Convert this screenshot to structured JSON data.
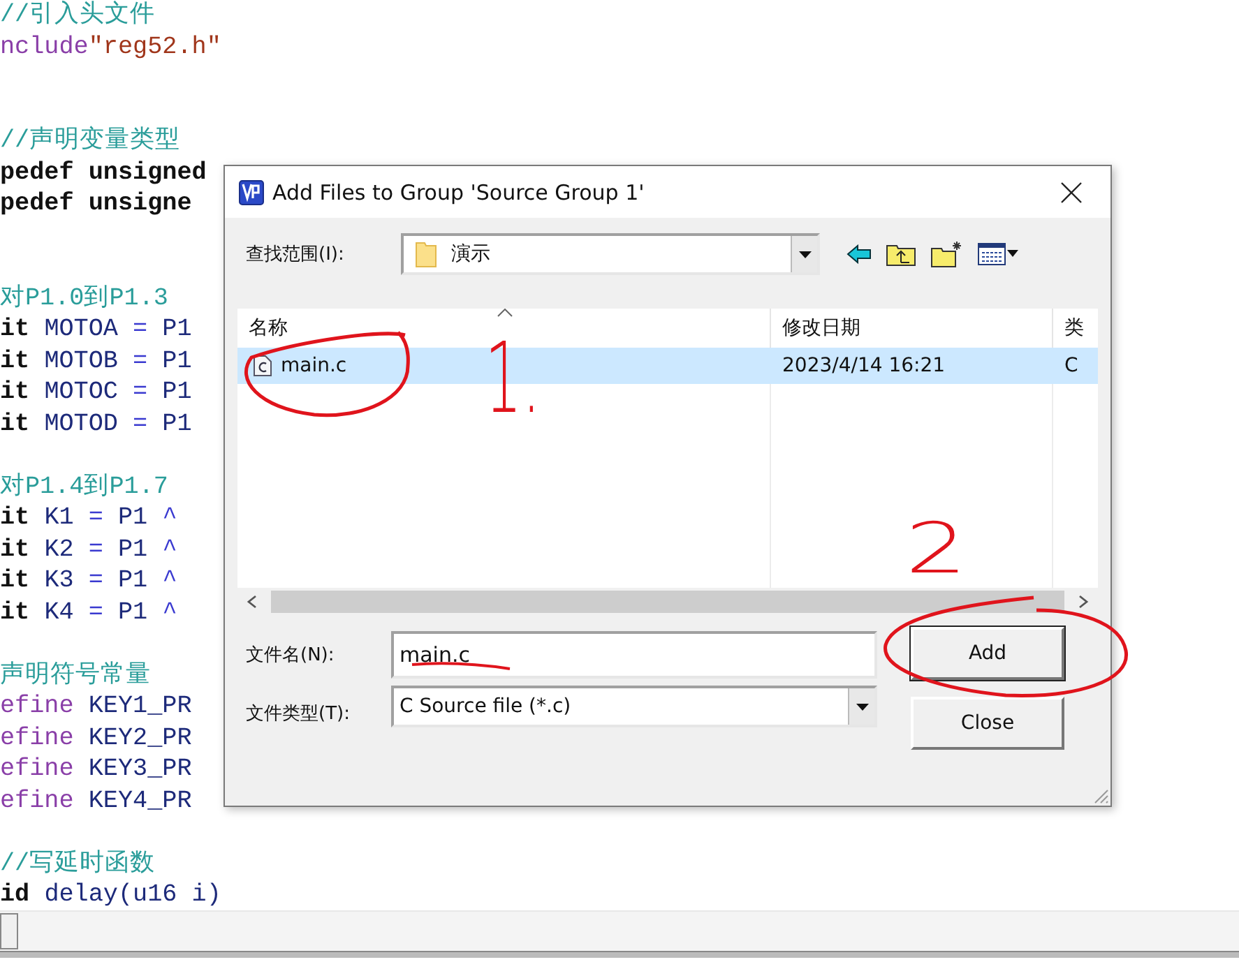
{
  "editor": {
    "lines": [
      {
        "kind": "code",
        "tokens": [
          {
            "kind": "comment",
            "text": "//引入头文件"
          }
        ]
      },
      {
        "kind": "code",
        "tokens": [
          {
            "kind": "directive",
            "text": "nclude"
          },
          {
            "kind": "string",
            "text": "\"reg52.h\""
          }
        ]
      },
      {
        "kind": "blank"
      },
      {
        "kind": "blank"
      },
      {
        "kind": "code",
        "tokens": [
          {
            "kind": "comment",
            "text": "//声明变量类型"
          }
        ]
      },
      {
        "kind": "code",
        "tokens": [
          {
            "kind": "keyword",
            "text": "pedef unsigned"
          }
        ]
      },
      {
        "kind": "code",
        "tokens": [
          {
            "kind": "keyword",
            "text": "pedef unsigne"
          }
        ]
      },
      {
        "kind": "blank"
      },
      {
        "kind": "blank"
      },
      {
        "kind": "code",
        "tokens": [
          {
            "kind": "comment",
            "text": "对P1.0到P1.3"
          }
        ]
      },
      {
        "kind": "code",
        "tokens": [
          {
            "kind": "keyword",
            "text": "it "
          },
          {
            "kind": "name",
            "text": "MOTOA "
          },
          {
            "kind": "operator",
            "text": "= "
          },
          {
            "kind": "name",
            "text": "P1"
          }
        ]
      },
      {
        "kind": "code",
        "tokens": [
          {
            "kind": "keyword",
            "text": "it "
          },
          {
            "kind": "name",
            "text": "MOTOB "
          },
          {
            "kind": "operator",
            "text": "= "
          },
          {
            "kind": "name",
            "text": "P1"
          }
        ]
      },
      {
        "kind": "code",
        "tokens": [
          {
            "kind": "keyword",
            "text": "it "
          },
          {
            "kind": "name",
            "text": "MOTOC "
          },
          {
            "kind": "operator",
            "text": "= "
          },
          {
            "kind": "name",
            "text": "P1"
          }
        ]
      },
      {
        "kind": "code",
        "tokens": [
          {
            "kind": "keyword",
            "text": "it "
          },
          {
            "kind": "name",
            "text": "MOTOD "
          },
          {
            "kind": "operator",
            "text": "= "
          },
          {
            "kind": "name",
            "text": "P1"
          }
        ]
      },
      {
        "kind": "blank"
      },
      {
        "kind": "code",
        "tokens": [
          {
            "kind": "comment",
            "text": "对P1.4到P1.7"
          }
        ]
      },
      {
        "kind": "code",
        "tokens": [
          {
            "kind": "keyword",
            "text": "it "
          },
          {
            "kind": "name",
            "text": "K1 "
          },
          {
            "kind": "operator",
            "text": "= "
          },
          {
            "kind": "name",
            "text": "P1 "
          },
          {
            "kind": "operator",
            "text": "^"
          }
        ]
      },
      {
        "kind": "code",
        "tokens": [
          {
            "kind": "keyword",
            "text": "it "
          },
          {
            "kind": "name",
            "text": "K2 "
          },
          {
            "kind": "operator",
            "text": "= "
          },
          {
            "kind": "name",
            "text": "P1 "
          },
          {
            "kind": "operator",
            "text": "^"
          }
        ]
      },
      {
        "kind": "code",
        "tokens": [
          {
            "kind": "keyword",
            "text": "it "
          },
          {
            "kind": "name",
            "text": "K3 "
          },
          {
            "kind": "operator",
            "text": "= "
          },
          {
            "kind": "name",
            "text": "P1 "
          },
          {
            "kind": "operator",
            "text": "^"
          }
        ]
      },
      {
        "kind": "code",
        "tokens": [
          {
            "kind": "keyword",
            "text": "it "
          },
          {
            "kind": "name",
            "text": "K4 "
          },
          {
            "kind": "operator",
            "text": "= "
          },
          {
            "kind": "name",
            "text": "P1 "
          },
          {
            "kind": "operator",
            "text": "^"
          }
        ]
      },
      {
        "kind": "blank"
      },
      {
        "kind": "code",
        "tokens": [
          {
            "kind": "comment",
            "text": "声明符号常量"
          }
        ]
      },
      {
        "kind": "code",
        "tokens": [
          {
            "kind": "directive",
            "text": "efine "
          },
          {
            "kind": "name",
            "text": "KEY1_PR"
          }
        ]
      },
      {
        "kind": "code",
        "tokens": [
          {
            "kind": "directive",
            "text": "efine "
          },
          {
            "kind": "name",
            "text": "KEY2_PR"
          }
        ]
      },
      {
        "kind": "code",
        "tokens": [
          {
            "kind": "directive",
            "text": "efine "
          },
          {
            "kind": "name",
            "text": "KEY3_PR"
          }
        ]
      },
      {
        "kind": "code",
        "tokens": [
          {
            "kind": "directive",
            "text": "efine "
          },
          {
            "kind": "name",
            "text": "KEY4_PR"
          }
        ]
      },
      {
        "kind": "blank"
      },
      {
        "kind": "code",
        "tokens": [
          {
            "kind": "comment",
            "text": "//写延时函数"
          }
        ]
      },
      {
        "kind": "code",
        "tokens": [
          {
            "kind": "keyword",
            "text": "id "
          },
          {
            "kind": "name",
            "text": "delay(u16 i)"
          }
        ]
      }
    ]
  },
  "dialog": {
    "title": "Add Files to Group 'Source Group 1'",
    "look_in": {
      "label": "查找范围(I):",
      "value": "演示"
    },
    "list": {
      "columns": [
        {
          "label": "名称",
          "sorted": true
        },
        {
          "label": "修改日期",
          "sorted": false
        },
        {
          "label": "类",
          "sorted": false
        }
      ],
      "rows": [
        {
          "name": "main.c",
          "modified": "2023/4/14 16:21",
          "type": "C",
          "selected": true
        }
      ]
    },
    "file_name": {
      "label": "文件名(N):",
      "value": "main.c"
    },
    "file_type": {
      "label": "文件类型(T):",
      "value": "C Source file (*.c)"
    },
    "buttons": [
      {
        "label": "Add",
        "default": true
      },
      {
        "label": "Close",
        "default": false
      }
    ]
  },
  "annotations": [
    "1.",
    "2"
  ]
}
